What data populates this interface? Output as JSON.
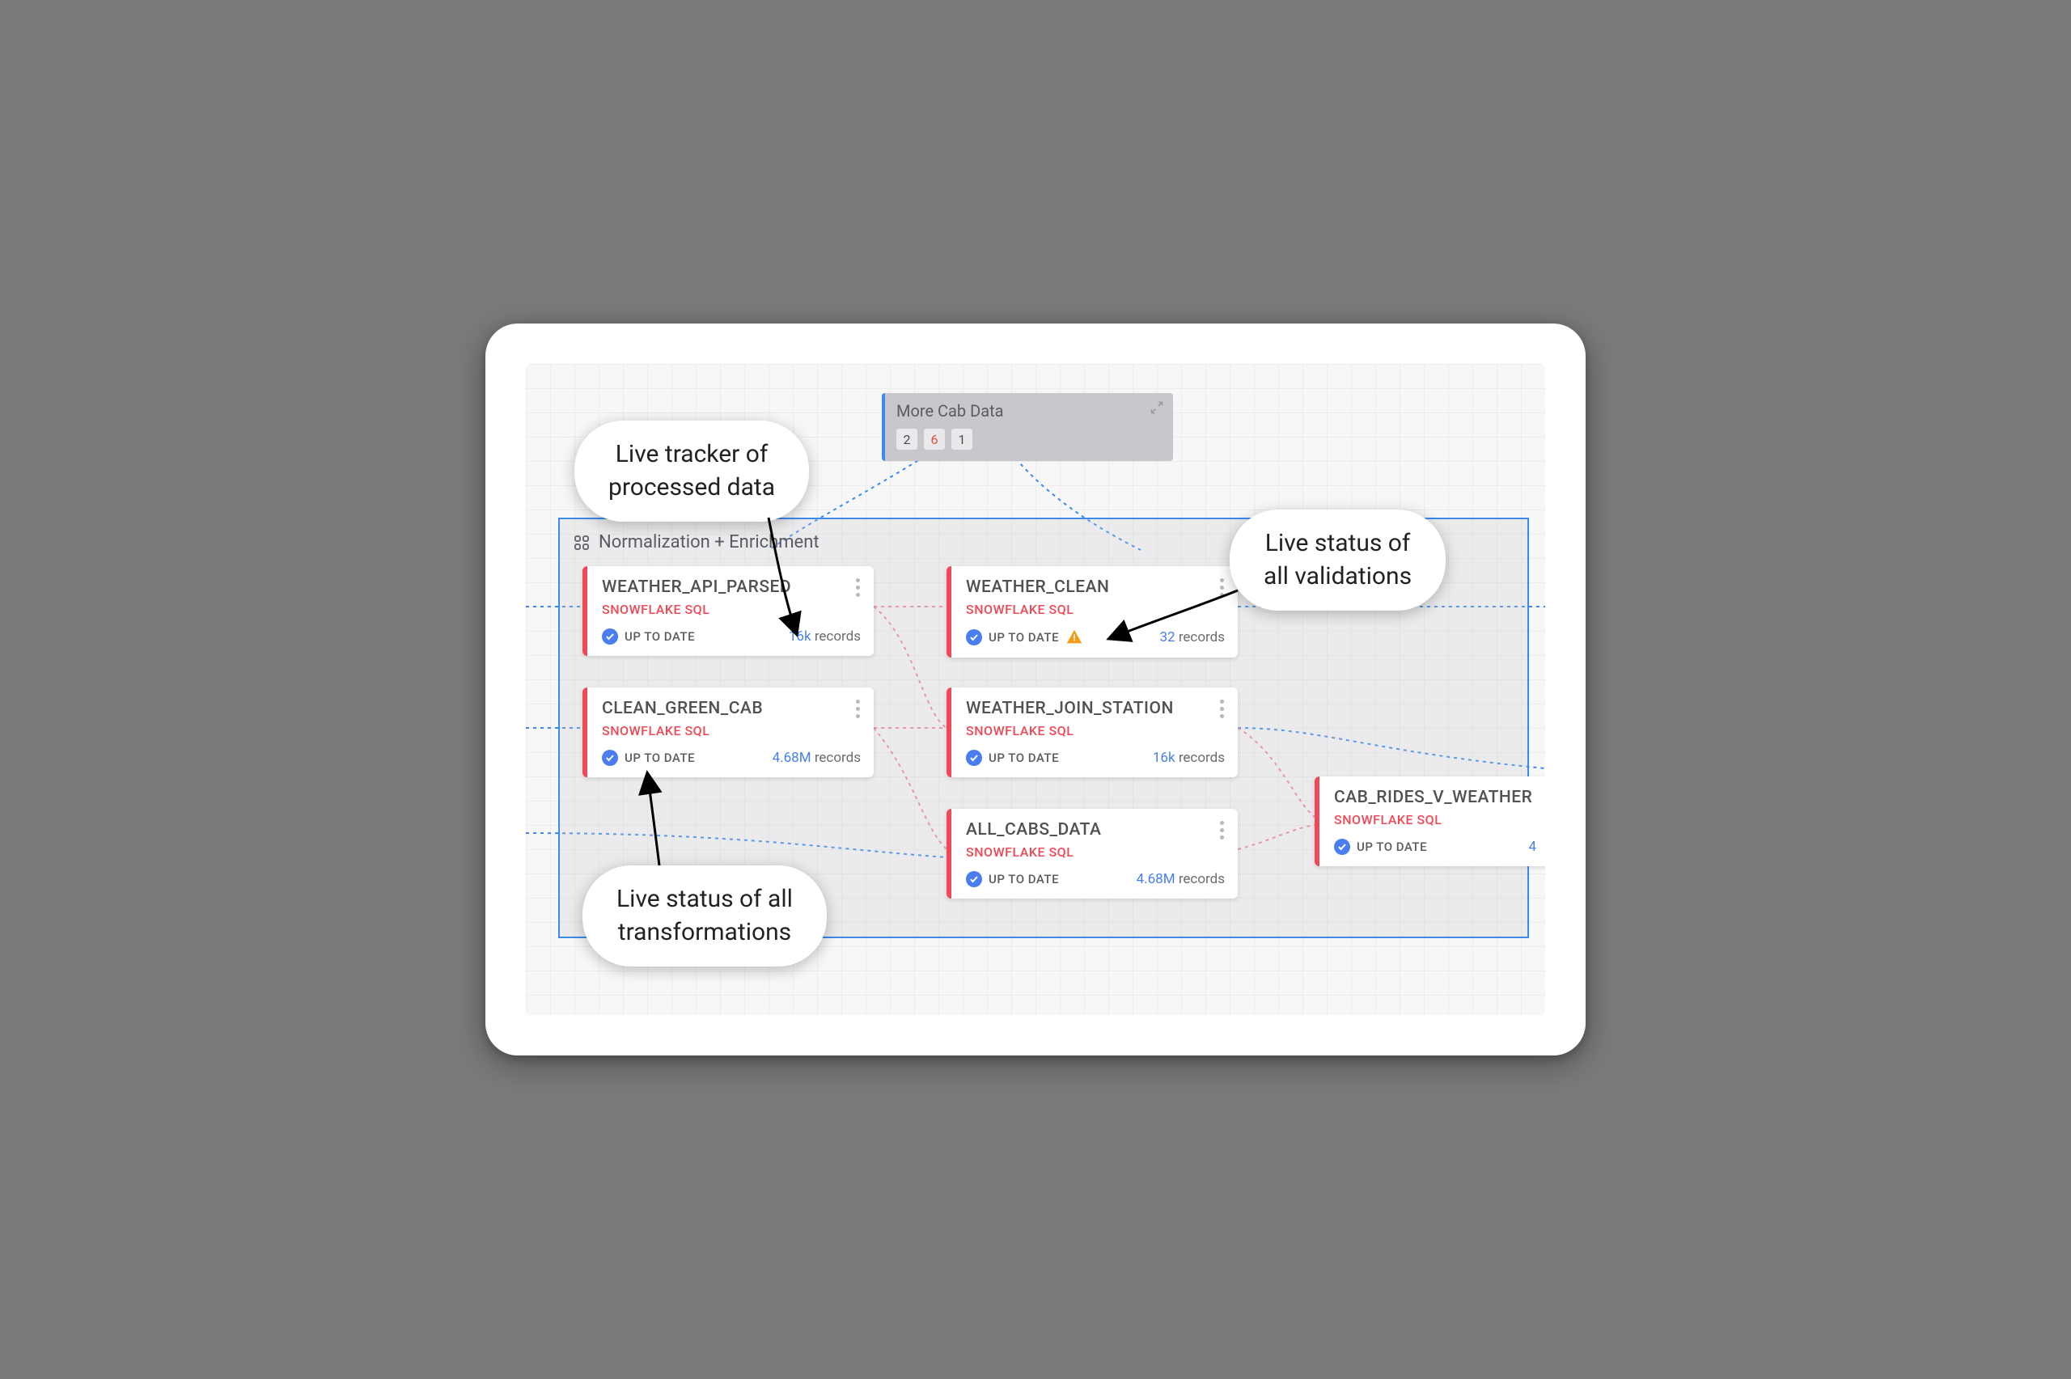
{
  "minibox": {
    "title": "More Cab Data",
    "counts": [
      "2",
      "6",
      "1"
    ]
  },
  "group": {
    "title": "Normalization + Enrichment"
  },
  "nodes": {
    "n1": {
      "title": "WEATHER_API_PARSED",
      "engine": "SNOWFLAKE SQL",
      "status": "UP TO DATE",
      "count": "16k",
      "count_unit": "records",
      "warn": false
    },
    "n2": {
      "title": "CLEAN_GREEN_CAB",
      "engine": "SNOWFLAKE SQL",
      "status": "UP TO DATE",
      "count": "4.68M",
      "count_unit": "records",
      "warn": false
    },
    "n3": {
      "title": "WEATHER_CLEAN",
      "engine": "SNOWFLAKE SQL",
      "status": "UP TO DATE",
      "count": "32",
      "count_unit": "records",
      "warn": true
    },
    "n4": {
      "title": "WEATHER_JOIN_STATION",
      "engine": "SNOWFLAKE SQL",
      "status": "UP TO DATE",
      "count": "16k",
      "count_unit": "records",
      "warn": false
    },
    "n5": {
      "title": "ALL_CABS_DATA",
      "engine": "SNOWFLAKE SQL",
      "status": "UP TO DATE",
      "count": "4.68M",
      "count_unit": "records",
      "warn": false
    },
    "n6": {
      "title": "CAB_RIDES_V_WEATHER",
      "engine": "SNOWFLAKE SQL",
      "status": "UP TO DATE",
      "count": "4",
      "count_unit": "",
      "warn": false
    }
  },
  "callouts": {
    "c1_l1": "Live tracker of",
    "c1_l2": "processed data",
    "c2_l1": "Live status of",
    "c2_l2": "all validations",
    "c3_l1": "Live status of all",
    "c3_l2": "transformations"
  }
}
